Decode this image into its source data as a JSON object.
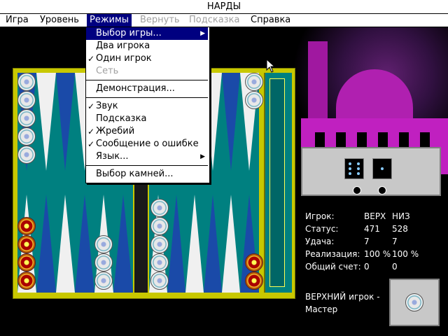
{
  "window": {
    "title": "НАРДЫ"
  },
  "menubar": {
    "items": [
      {
        "label": "Игра",
        "state": "normal"
      },
      {
        "label": "Уровень",
        "state": "normal"
      },
      {
        "label": "Режимы",
        "state": "active"
      },
      {
        "label": "Вернуть",
        "state": "disabled"
      },
      {
        "label": "Подсказка",
        "state": "disabled"
      },
      {
        "label": "Справка",
        "state": "normal"
      }
    ]
  },
  "dropdown": {
    "items": [
      {
        "label": "Выбор игры...",
        "checked": false,
        "submenu": true,
        "disabled": false,
        "highlighted": true
      },
      {
        "label": "Два игрока",
        "checked": false,
        "submenu": false,
        "disabled": false,
        "highlighted": false
      },
      {
        "label": "Один игрок",
        "checked": true,
        "submenu": false,
        "disabled": false,
        "highlighted": false
      },
      {
        "label": "Сеть",
        "checked": false,
        "submenu": false,
        "disabled": true,
        "highlighted": false
      },
      {
        "label": "Демонстрация...",
        "checked": false,
        "submenu": false,
        "disabled": false,
        "highlighted": false
      },
      {
        "label": "Звук",
        "checked": true,
        "submenu": false,
        "disabled": false,
        "highlighted": false
      },
      {
        "label": "Подсказка",
        "checked": false,
        "submenu": false,
        "disabled": false,
        "highlighted": false
      },
      {
        "label": "Жребий",
        "checked": true,
        "submenu": false,
        "disabled": false,
        "highlighted": false
      },
      {
        "label": "Сообщение о ошибке",
        "checked": true,
        "submenu": false,
        "disabled": false,
        "highlighted": false
      },
      {
        "label": "Язык...",
        "checked": false,
        "submenu": true,
        "disabled": false,
        "highlighted": false
      },
      {
        "label": "Выбор камней...",
        "checked": false,
        "submenu": false,
        "disabled": false,
        "highlighted": false
      }
    ],
    "check_mark": "✓",
    "submenu_arrow": "▶"
  },
  "dice": {
    "values": [
      6,
      1
    ]
  },
  "stats": {
    "header": {
      "label": "Игрок:",
      "col1": "ВЕРХ",
      "col2": "НИЗ"
    },
    "rows": [
      {
        "label": "Статус:",
        "col1": "471",
        "col2": "528"
      },
      {
        "label": "Удача:",
        "col1": "7",
        "col2": "7"
      },
      {
        "label": "Реализация:",
        "col1": "100 %",
        "col2": "100 %"
      },
      {
        "label": "Общий счет:",
        "col1": "0",
        "col2": "0"
      }
    ]
  },
  "message": {
    "line1": "ВЕРХНИЙ игрок -",
    "line2": "Мастер"
  },
  "colors": {
    "board_frame": "#c8c800",
    "felt": "#008080",
    "menu_highlight": "#000080",
    "castle": "#c020c0"
  },
  "icons": [
    "check-icon",
    "submenu-arrow-icon",
    "die-icon",
    "checker-white-icon",
    "checker-black-icon",
    "mouse-cursor-icon"
  ]
}
